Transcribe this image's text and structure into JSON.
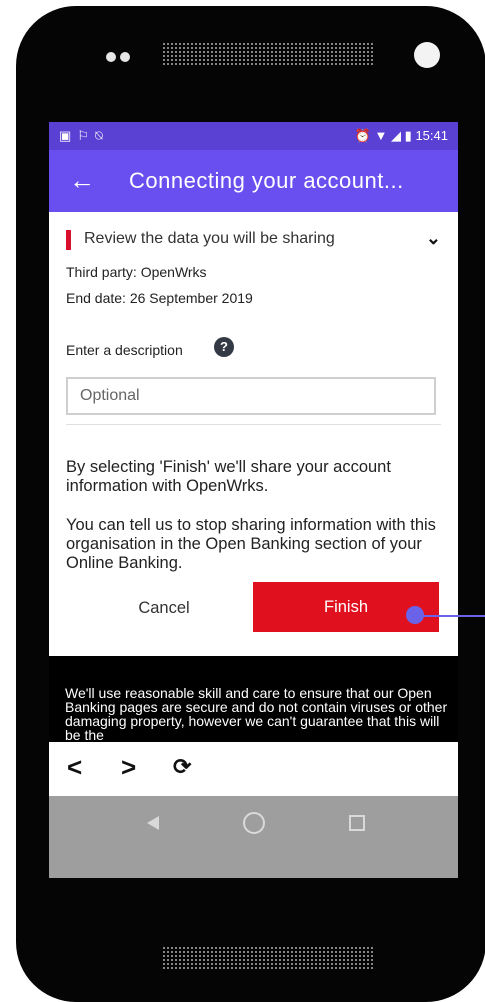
{
  "status_bar": {
    "left_icons": [
      "image-icon",
      "flag-icon",
      "notifications-off-icon"
    ],
    "right_icons": [
      "alarm-icon",
      "wifi-icon",
      "signal-icon",
      "battery-icon"
    ],
    "time": "15:41"
  },
  "app_bar": {
    "back_icon": "arrow-left-icon",
    "title": "Connecting your account..."
  },
  "review": {
    "label": "Review the data you will be sharing",
    "toggle_icon": "chevron-down-icon"
  },
  "details": {
    "third_party": "Third party: OpenWrks",
    "end_date": "End date: 26 September 2019"
  },
  "description": {
    "label": "Enter a description",
    "help_icon": "?",
    "placeholder": "Optional"
  },
  "info": {
    "para1": "By selecting 'Finish' we'll share your account information with OpenWrks.",
    "para2": "You can tell us to stop sharing information with this organisation in the Open Banking section of your Online Banking."
  },
  "buttons": {
    "cancel": "Cancel",
    "finish": "Finish"
  },
  "footer_text": "We'll use reasonable skill and care to ensure that our Open Banking pages are secure and do not contain viruses or other damaging property, however we can't guarantee that this will be the",
  "browser_nav": [
    "chevron-left-icon",
    "chevron-right-icon",
    "refresh-icon"
  ],
  "system_nav": [
    "back-icon",
    "home-icon",
    "recents-icon"
  ],
  "colors": {
    "accent": "#6a4ff0",
    "status_bar": "#5a41d3",
    "finish": "#e0101f",
    "marker": "#d90f2e"
  }
}
